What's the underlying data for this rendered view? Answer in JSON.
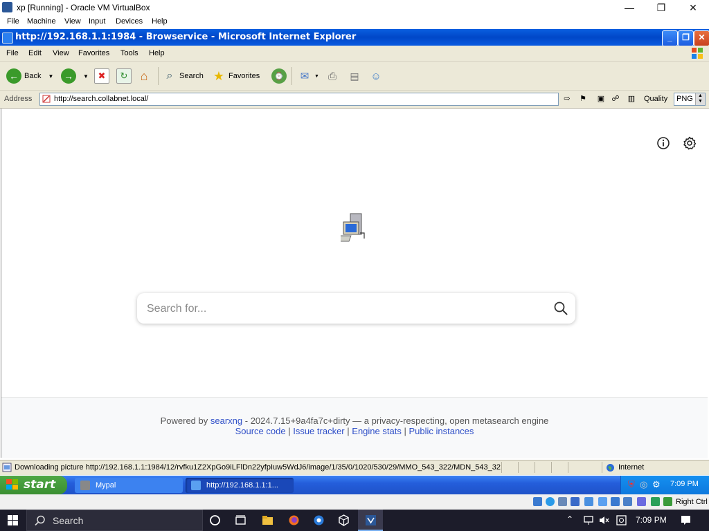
{
  "vbox": {
    "title": "xp [Running] - Oracle VM VirtualBox",
    "menu": [
      "File",
      "Machine",
      "View",
      "Input",
      "Devices",
      "Help"
    ],
    "status_right": "Right Ctrl"
  },
  "ie": {
    "title": "http://192.168.1.1:1984 - Browservice - Microsoft Internet Explorer",
    "menu": [
      "File",
      "Edit",
      "View",
      "Favorites",
      "Tools",
      "Help"
    ],
    "toolbar": {
      "back": "Back",
      "search": "Search",
      "favorites": "Favorites"
    },
    "address_label": "Address",
    "address_value": "http://search.collabnet.local/",
    "quality_label": "Quality",
    "quality_value": "PNG",
    "status_text": "Downloading picture http://192.168.1.1:1984/12/rvfku1Z2XpGo9iLFlDn22yfpIuw5WdJ6/image/1/35/0/1020/530/29/MMO_543_322/MDN_543_32",
    "zone": "Internet"
  },
  "page": {
    "search_placeholder": "Search for...",
    "footer_powered": "Powered by",
    "footer_searxng": "searxng",
    "footer_rest": "- 2024.7.15+9a4fa7c+dirty — a privacy-respecting, open metasearch engine",
    "footer_links": [
      "Source code",
      "Issue tracker",
      "Engine stats",
      "Public instances"
    ],
    "footer_sep": "|"
  },
  "xp_taskbar": {
    "start": "start",
    "tasks": [
      "Mypal",
      "http://192.168.1.1:1..."
    ],
    "clock": "7:09 PM"
  },
  "w10_taskbar": {
    "search": "Search",
    "clock": "7:09 PM"
  },
  "colors": {
    "xp_title_blue": "#0047c8",
    "xp_start_green": "#3a8f31",
    "link_blue": "#3050c8"
  }
}
